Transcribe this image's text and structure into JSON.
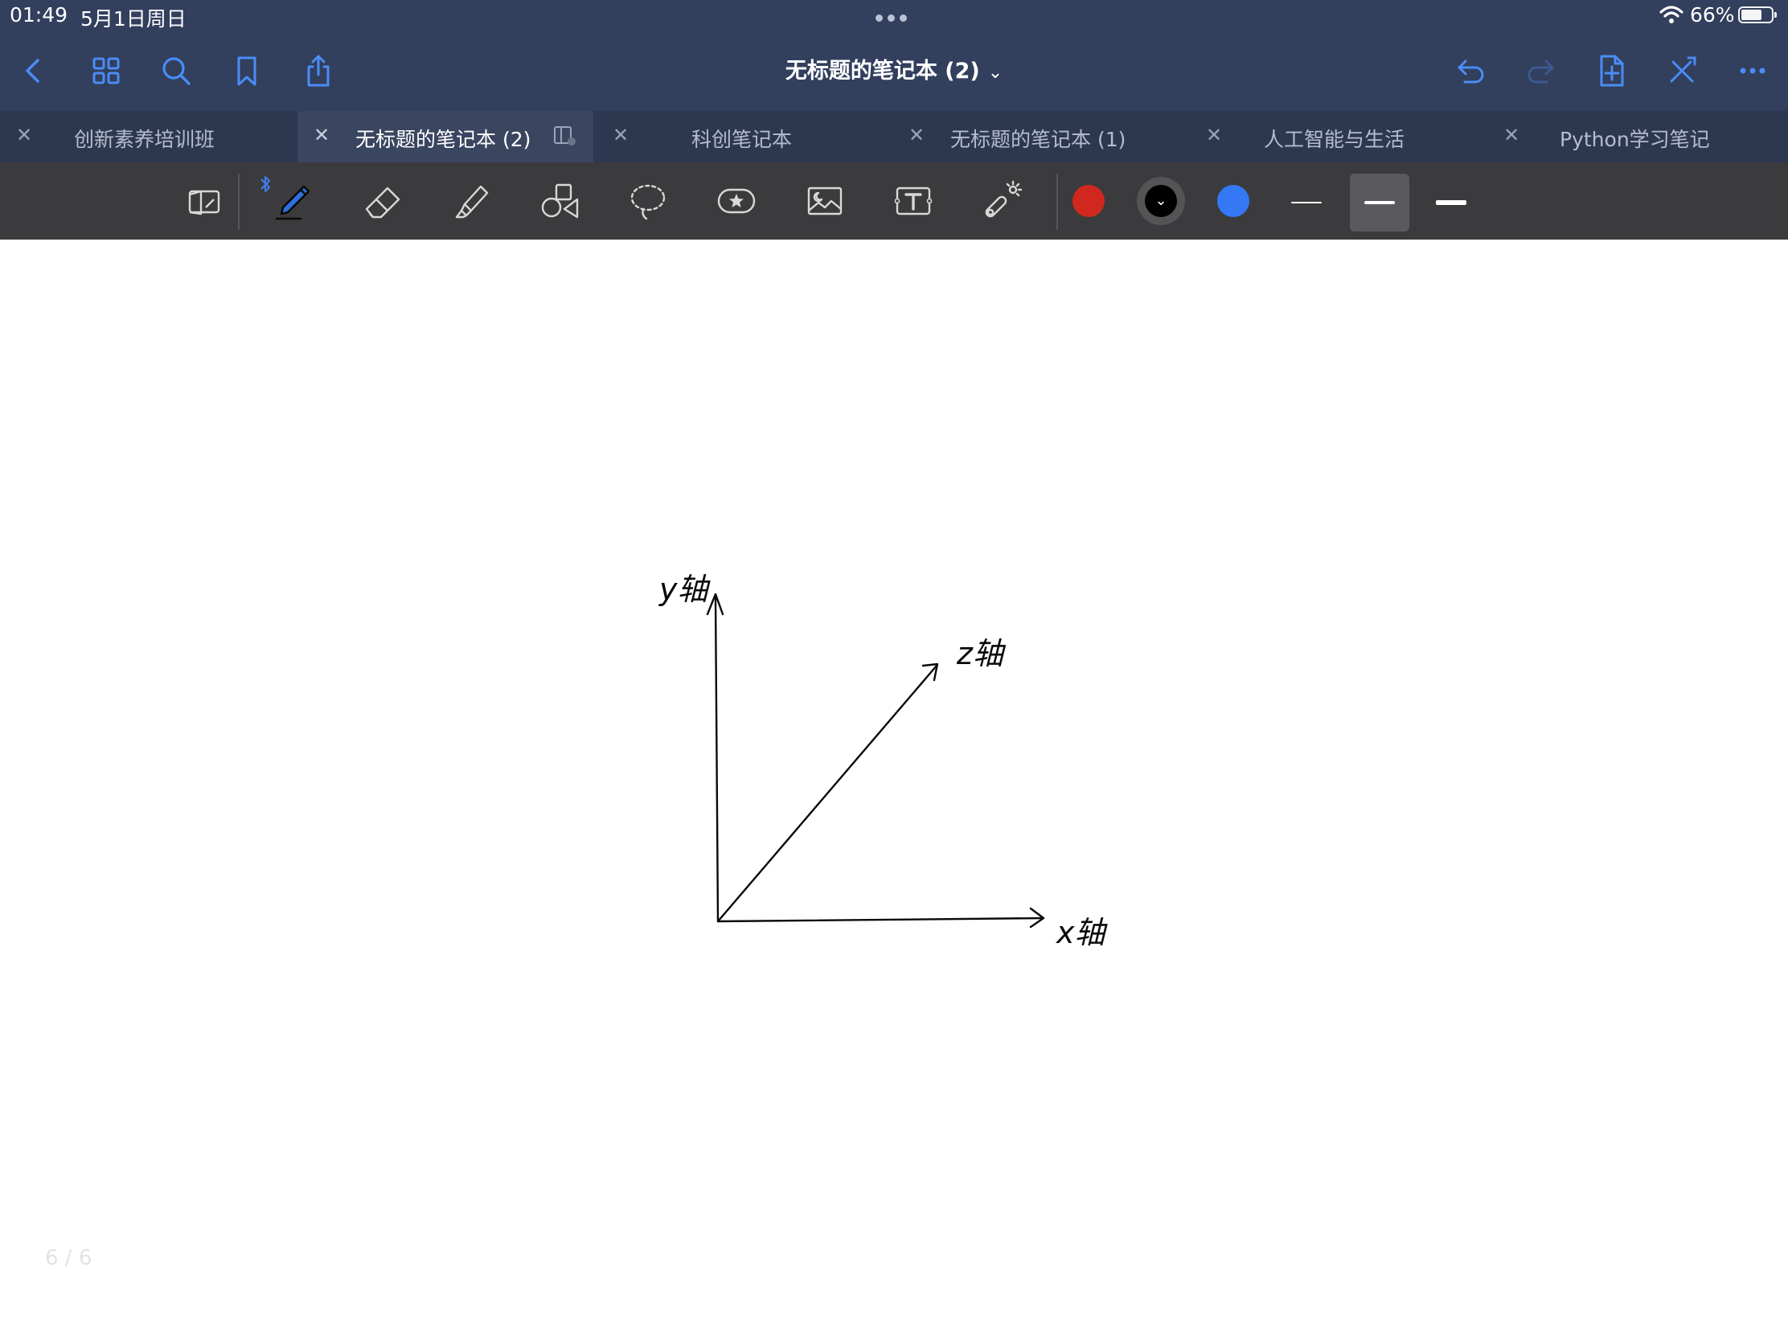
{
  "status_bar": {
    "time": "01:49",
    "date": "5月1日周日",
    "battery": "66%",
    "battery_level": 0.66
  },
  "nav": {
    "title": "无标题的笔记本 (2)",
    "title_chevron": "⌄",
    "accent_color": "#4a8df5",
    "left_icons": [
      "back-icon",
      "grid-icon",
      "search-icon",
      "bookmark-icon",
      "share-icon"
    ],
    "right_icons": [
      "undo-icon",
      "redo-icon",
      "add-page-icon",
      "close-toolbar-icon",
      "more-icon"
    ]
  },
  "tabs": [
    {
      "label": "创新素养培训班",
      "active": false
    },
    {
      "label": "无标题的笔记本 (2)",
      "active": true
    },
    {
      "label": "科创笔记本",
      "active": false
    },
    {
      "label": "无标题的笔记本 (1)",
      "active": false
    },
    {
      "label": "人工智能与生活",
      "active": false
    },
    {
      "label": "Python学习笔记",
      "active": false
    }
  ],
  "toolbar": {
    "tools": [
      "read-only-mode-icon",
      "pen-icon",
      "eraser-icon",
      "highlighter-icon",
      "shapes-icon",
      "lasso-icon",
      "elements-icon",
      "image-icon",
      "text-icon",
      "laser-pointer-icon"
    ],
    "active_tool": "pen-icon",
    "bluetooth_indicator": "bluetooth-icon",
    "colors": [
      "#d0281e",
      "#000000",
      "#3478f6"
    ],
    "selected_color": "#000000",
    "strokes": [
      "thin",
      "medium",
      "thick"
    ],
    "selected_stroke": "medium"
  },
  "canvas": {
    "handwritten_labels": {
      "y_axis": "y轴",
      "z_axis": "z轴",
      "x_axis": "x轴"
    },
    "page_indicator": "6 / 6"
  }
}
